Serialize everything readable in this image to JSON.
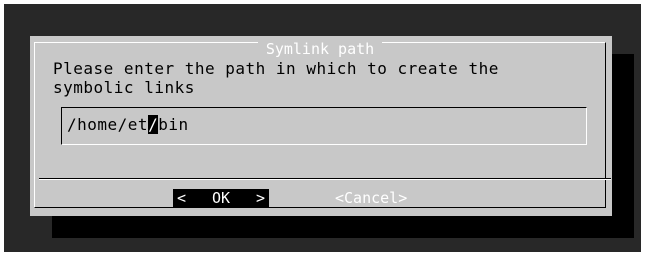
{
  "dialog": {
    "title": "Symlink path",
    "prompt_lines": [
      "Please enter the path in which to create the",
      "symbolic links"
    ]
  },
  "input": {
    "value_before_cursor": "/home/et",
    "cursor_char": "/",
    "value_after_cursor": "bin"
  },
  "buttons": {
    "ok": {
      "left": "<",
      "label": "OK",
      "right": ">"
    },
    "cancel_label": "<Cancel>"
  },
  "colors": {
    "terminal_bg": "#282828",
    "dialog_bg": "#c8c8c8",
    "shadow": "#000000",
    "selected_button_bg": "#000000"
  }
}
